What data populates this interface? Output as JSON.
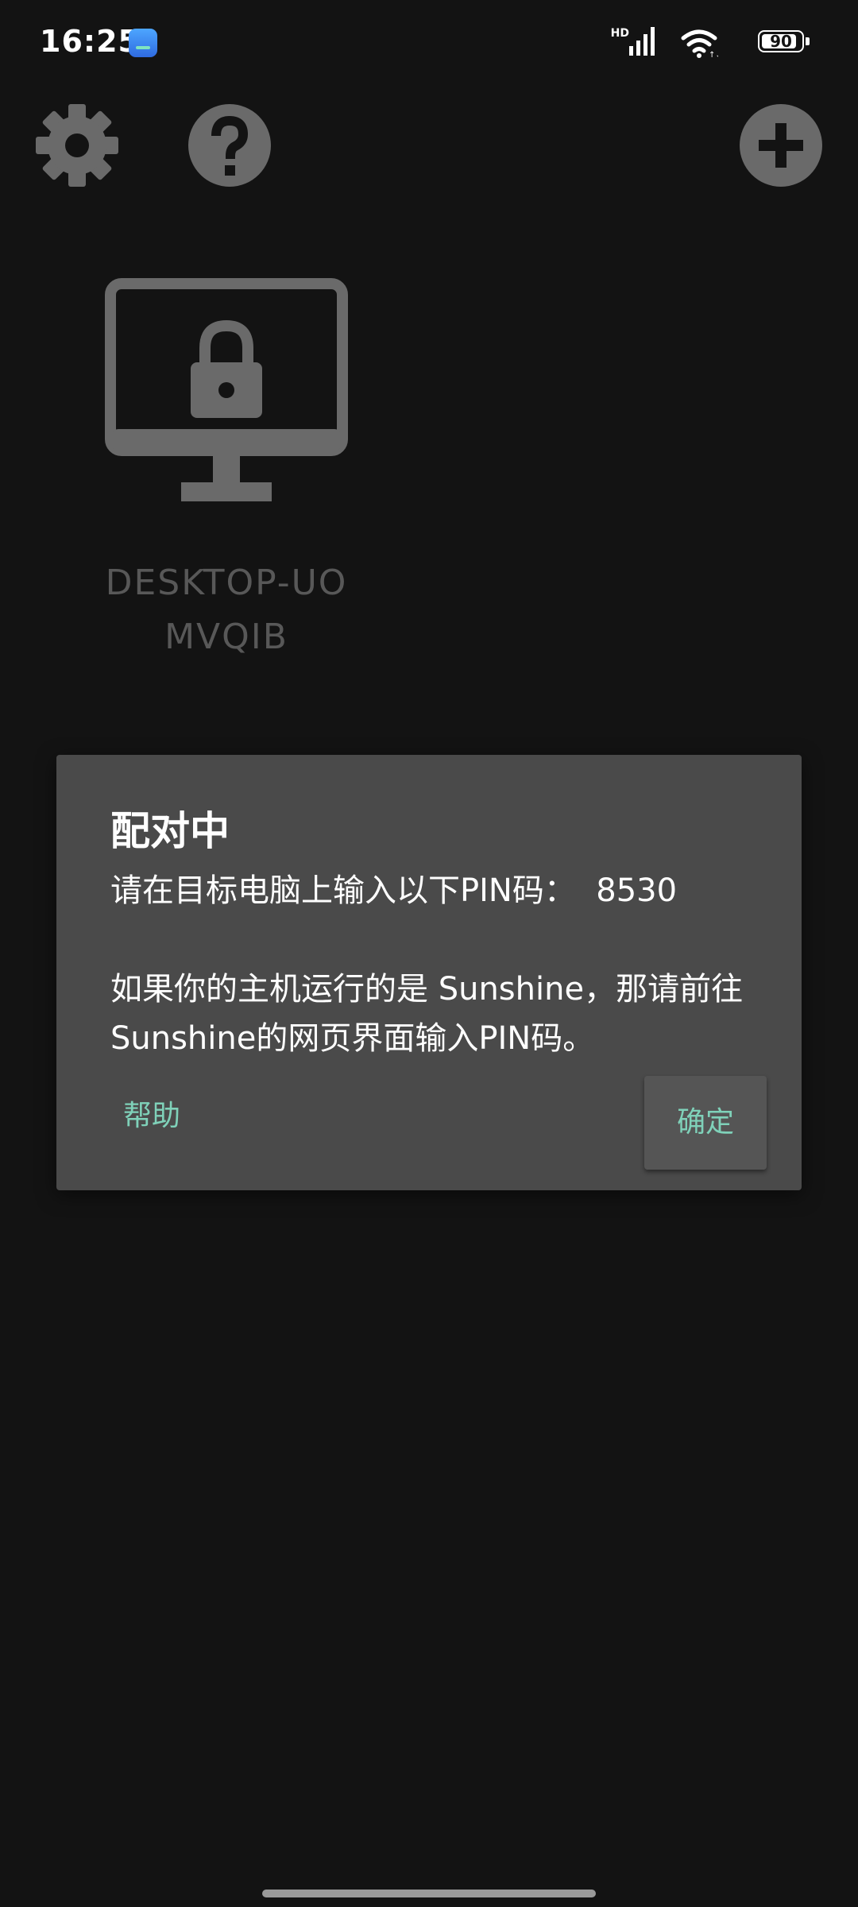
{
  "status_bar": {
    "time": "16:25",
    "network_label": "HD",
    "battery_level": "90",
    "battery_fraction": 0.9,
    "icons": [
      "app-notification-icon",
      "signal-icon",
      "wifi-icon",
      "battery-icon"
    ]
  },
  "toolbar": {
    "settings_icon": "gear-icon",
    "help_icon": "question-mark-icon",
    "add_icon": "plus-icon"
  },
  "pc": {
    "name": "DESKTOP-UOMVQIB",
    "icon": "locked-monitor-icon",
    "icon_color": "#6a6a6a"
  },
  "dialog": {
    "title": "配对中",
    "message": "请在目标电脑上输入以下PIN码：  8530\n\n如果你的主机运行的是 Sunshine，那请前往Sunshine的网页界面输入PIN码。",
    "help_label": "帮助",
    "ok_label": "确定",
    "accent_color": "#7fd1b9",
    "background_color": "#4a4a4a"
  }
}
